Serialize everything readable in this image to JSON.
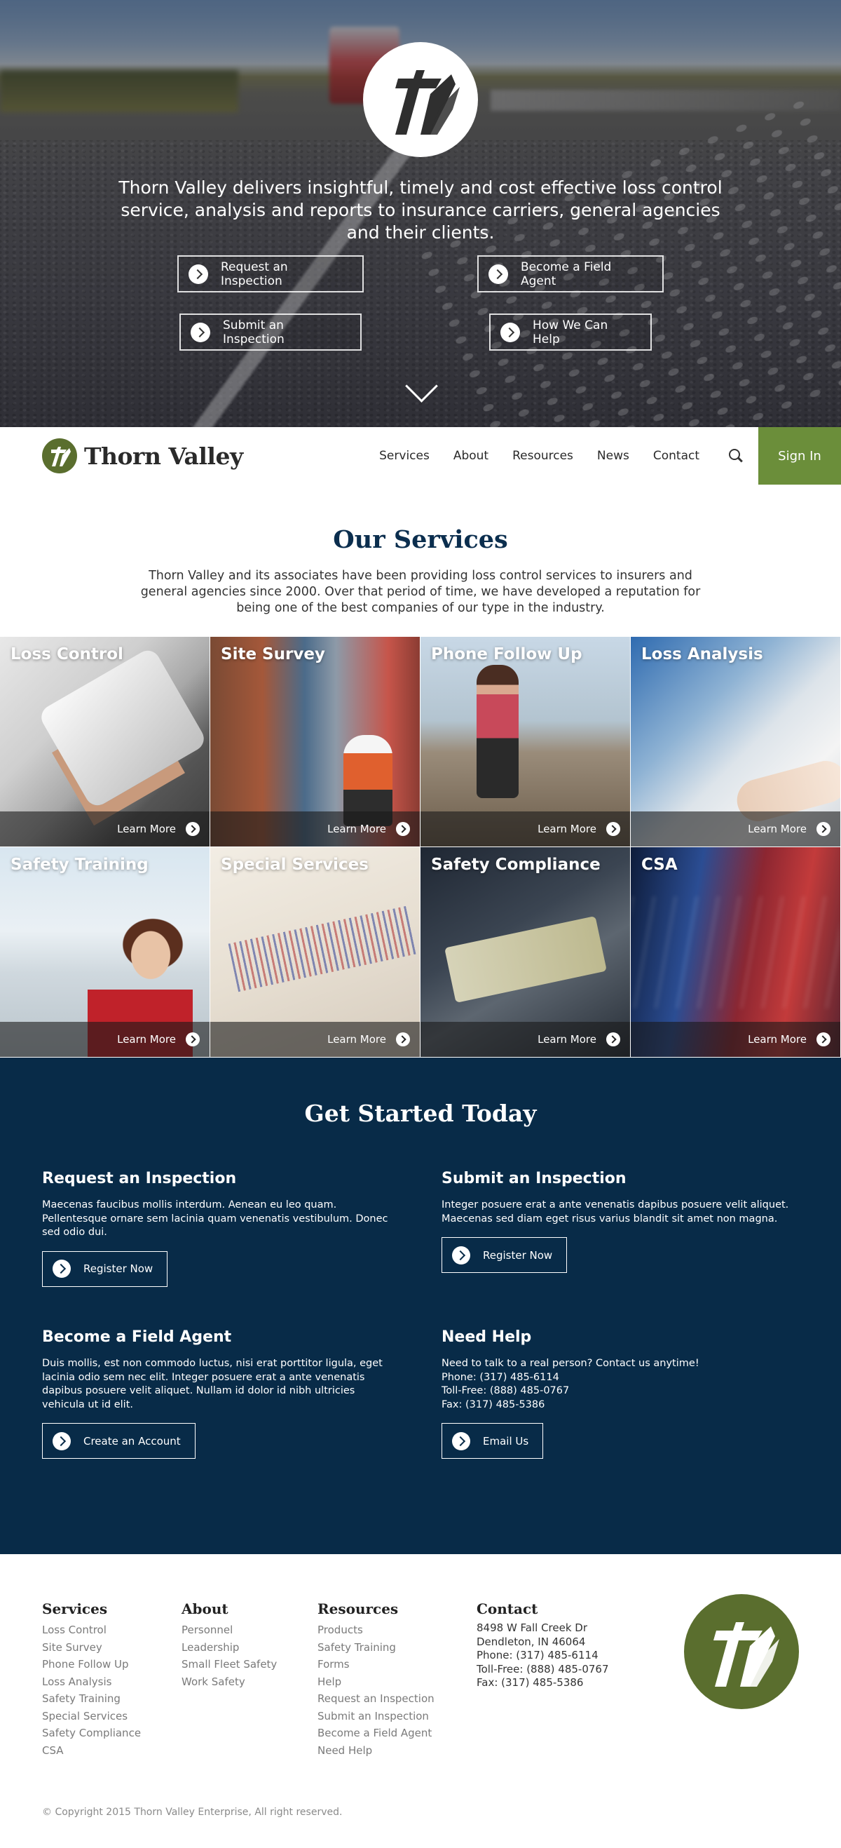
{
  "hero": {
    "tagline": "Thorn Valley delivers insightful, timely and cost effective loss control service, analysis and reports to insurance carriers, general agencies and their clients.",
    "buttons": [
      {
        "label": "Request an Inspection"
      },
      {
        "label": "Become a Field Agent"
      },
      {
        "label": "Submit an Inspection"
      },
      {
        "label": "How We Can Help"
      }
    ],
    "scroll_icon": "chevron-down-icon"
  },
  "nav": {
    "brand": "Thorn Valley",
    "items": [
      {
        "label": "Services"
      },
      {
        "label": "About"
      },
      {
        "label": "Resources"
      },
      {
        "label": "News"
      },
      {
        "label": "Contact"
      }
    ],
    "search_icon": "search-icon",
    "signin": "Sign In",
    "accent_color": "#6b8e3a"
  },
  "services": {
    "title": "Our Services",
    "intro": "Thorn Valley and its associates have been providing loss control services to insurers and general agencies since 2000. Over that period of time, we have developed a reputation for being one of the best companies of our type in the industry.",
    "tiles": [
      {
        "title": "Loss Control",
        "cta": "Learn More"
      },
      {
        "title": "Site Survey",
        "cta": "Learn More"
      },
      {
        "title": "Phone Follow Up",
        "cta": "Learn More"
      },
      {
        "title": "Loss Analysis",
        "cta": "Learn More"
      },
      {
        "title": "Safety Training",
        "cta": "Learn More"
      },
      {
        "title": "Special Services",
        "cta": "Learn More"
      },
      {
        "title": "Safety Compliance",
        "cta": "Learn More"
      },
      {
        "title": "CSA",
        "cta": "Learn More"
      }
    ]
  },
  "get_started": {
    "title": "Get Started Today",
    "background_color": "#082b48",
    "blocks": [
      {
        "heading": "Request an Inspection",
        "body": "Maecenas faucibus mollis interdum. Aenean eu leo quam.\nPellentesque ornare sem lacinia quam venenatis vestibulum. Donec\nsed odio dui.",
        "button": "Register Now"
      },
      {
        "heading": "Submit an Inspection",
        "body": "Integer posuere erat a ante venenatis dapibus posuere velit aliquet.\nMaecenas sed diam eget risus varius blandit sit amet non magna.",
        "button": "Register Now"
      },
      {
        "heading": "Become a Field Agent",
        "body": "Duis mollis, est non commodo luctus, nisi erat porttitor ligula, eget\nlacinia odio sem nec elit. Integer posuere erat a ante venenatis\ndapibus posuere velit aliquet. Nullam id dolor id nibh ultricies\nvehicula ut id elit.",
        "button": "Create an Account"
      },
      {
        "heading": "Need Help",
        "body": "Need to talk to a real person? Contact us anytime!\nPhone: (317) 485-6114\nToll-Free: (888) 485-0767\nFax: (317) 485-5386",
        "button": "Email Us"
      }
    ]
  },
  "footer": {
    "columns": [
      {
        "heading": "Services",
        "links": [
          "Loss Control",
          "Site Survey",
          "Phone Follow Up",
          "Loss Analysis",
          "Safety Training",
          "Special Services",
          "Safety Compliance",
          "CSA"
        ]
      },
      {
        "heading": "About",
        "links": [
          "Personnel",
          "Leadership",
          "Small Fleet Safety",
          "Work Safety"
        ]
      },
      {
        "heading": "Resources",
        "links": [
          "Products",
          "Safety Training",
          "Forms",
          "Help",
          "Request an Inspection",
          "Submit an Inspection",
          "Become a Field Agent",
          "Need Help"
        ]
      }
    ],
    "contact": {
      "heading": "Contact",
      "lines": [
        "8498 W Fall Creek Dr",
        "Dendleton, IN 46064",
        "Phone: (317) 485-6114",
        "Toll-Free: (888) 485-0767",
        "Fax: (317) 485-5386"
      ]
    },
    "copyright": "© Copyright 2015 Thorn Valley Enterprise, All right reserved.",
    "logo_color": "#5a6e2e"
  }
}
